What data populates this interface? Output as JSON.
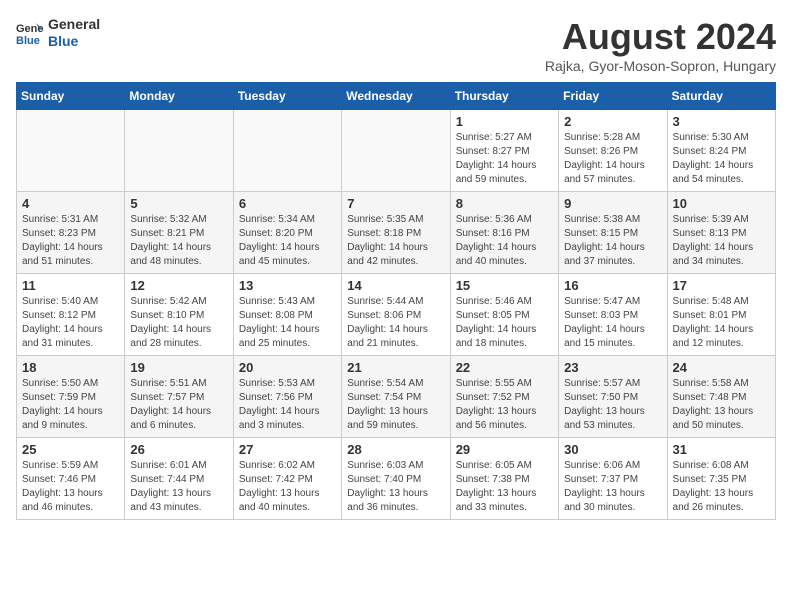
{
  "logo": {
    "line1": "General",
    "line2": "Blue"
  },
  "title": "August 2024",
  "subtitle": "Rajka, Gyor-Moson-Sopron, Hungary",
  "days_of_week": [
    "Sunday",
    "Monday",
    "Tuesday",
    "Wednesday",
    "Thursday",
    "Friday",
    "Saturday"
  ],
  "weeks": [
    [
      {
        "day": "",
        "detail": ""
      },
      {
        "day": "",
        "detail": ""
      },
      {
        "day": "",
        "detail": ""
      },
      {
        "day": "",
        "detail": ""
      },
      {
        "day": "1",
        "detail": "Sunrise: 5:27 AM\nSunset: 8:27 PM\nDaylight: 14 hours\nand 59 minutes."
      },
      {
        "day": "2",
        "detail": "Sunrise: 5:28 AM\nSunset: 8:26 PM\nDaylight: 14 hours\nand 57 minutes."
      },
      {
        "day": "3",
        "detail": "Sunrise: 5:30 AM\nSunset: 8:24 PM\nDaylight: 14 hours\nand 54 minutes."
      }
    ],
    [
      {
        "day": "4",
        "detail": "Sunrise: 5:31 AM\nSunset: 8:23 PM\nDaylight: 14 hours\nand 51 minutes."
      },
      {
        "day": "5",
        "detail": "Sunrise: 5:32 AM\nSunset: 8:21 PM\nDaylight: 14 hours\nand 48 minutes."
      },
      {
        "day": "6",
        "detail": "Sunrise: 5:34 AM\nSunset: 8:20 PM\nDaylight: 14 hours\nand 45 minutes."
      },
      {
        "day": "7",
        "detail": "Sunrise: 5:35 AM\nSunset: 8:18 PM\nDaylight: 14 hours\nand 42 minutes."
      },
      {
        "day": "8",
        "detail": "Sunrise: 5:36 AM\nSunset: 8:16 PM\nDaylight: 14 hours\nand 40 minutes."
      },
      {
        "day": "9",
        "detail": "Sunrise: 5:38 AM\nSunset: 8:15 PM\nDaylight: 14 hours\nand 37 minutes."
      },
      {
        "day": "10",
        "detail": "Sunrise: 5:39 AM\nSunset: 8:13 PM\nDaylight: 14 hours\nand 34 minutes."
      }
    ],
    [
      {
        "day": "11",
        "detail": "Sunrise: 5:40 AM\nSunset: 8:12 PM\nDaylight: 14 hours\nand 31 minutes."
      },
      {
        "day": "12",
        "detail": "Sunrise: 5:42 AM\nSunset: 8:10 PM\nDaylight: 14 hours\nand 28 minutes."
      },
      {
        "day": "13",
        "detail": "Sunrise: 5:43 AM\nSunset: 8:08 PM\nDaylight: 14 hours\nand 25 minutes."
      },
      {
        "day": "14",
        "detail": "Sunrise: 5:44 AM\nSunset: 8:06 PM\nDaylight: 14 hours\nand 21 minutes."
      },
      {
        "day": "15",
        "detail": "Sunrise: 5:46 AM\nSunset: 8:05 PM\nDaylight: 14 hours\nand 18 minutes."
      },
      {
        "day": "16",
        "detail": "Sunrise: 5:47 AM\nSunset: 8:03 PM\nDaylight: 14 hours\nand 15 minutes."
      },
      {
        "day": "17",
        "detail": "Sunrise: 5:48 AM\nSunset: 8:01 PM\nDaylight: 14 hours\nand 12 minutes."
      }
    ],
    [
      {
        "day": "18",
        "detail": "Sunrise: 5:50 AM\nSunset: 7:59 PM\nDaylight: 14 hours\nand 9 minutes."
      },
      {
        "day": "19",
        "detail": "Sunrise: 5:51 AM\nSunset: 7:57 PM\nDaylight: 14 hours\nand 6 minutes."
      },
      {
        "day": "20",
        "detail": "Sunrise: 5:53 AM\nSunset: 7:56 PM\nDaylight: 14 hours\nand 3 minutes."
      },
      {
        "day": "21",
        "detail": "Sunrise: 5:54 AM\nSunset: 7:54 PM\nDaylight: 13 hours\nand 59 minutes."
      },
      {
        "day": "22",
        "detail": "Sunrise: 5:55 AM\nSunset: 7:52 PM\nDaylight: 13 hours\nand 56 minutes."
      },
      {
        "day": "23",
        "detail": "Sunrise: 5:57 AM\nSunset: 7:50 PM\nDaylight: 13 hours\nand 53 minutes."
      },
      {
        "day": "24",
        "detail": "Sunrise: 5:58 AM\nSunset: 7:48 PM\nDaylight: 13 hours\nand 50 minutes."
      }
    ],
    [
      {
        "day": "25",
        "detail": "Sunrise: 5:59 AM\nSunset: 7:46 PM\nDaylight: 13 hours\nand 46 minutes."
      },
      {
        "day": "26",
        "detail": "Sunrise: 6:01 AM\nSunset: 7:44 PM\nDaylight: 13 hours\nand 43 minutes."
      },
      {
        "day": "27",
        "detail": "Sunrise: 6:02 AM\nSunset: 7:42 PM\nDaylight: 13 hours\nand 40 minutes."
      },
      {
        "day": "28",
        "detail": "Sunrise: 6:03 AM\nSunset: 7:40 PM\nDaylight: 13 hours\nand 36 minutes."
      },
      {
        "day": "29",
        "detail": "Sunrise: 6:05 AM\nSunset: 7:38 PM\nDaylight: 13 hours\nand 33 minutes."
      },
      {
        "day": "30",
        "detail": "Sunrise: 6:06 AM\nSunset: 7:37 PM\nDaylight: 13 hours\nand 30 minutes."
      },
      {
        "day": "31",
        "detail": "Sunrise: 6:08 AM\nSunset: 7:35 PM\nDaylight: 13 hours\nand 26 minutes."
      }
    ]
  ]
}
